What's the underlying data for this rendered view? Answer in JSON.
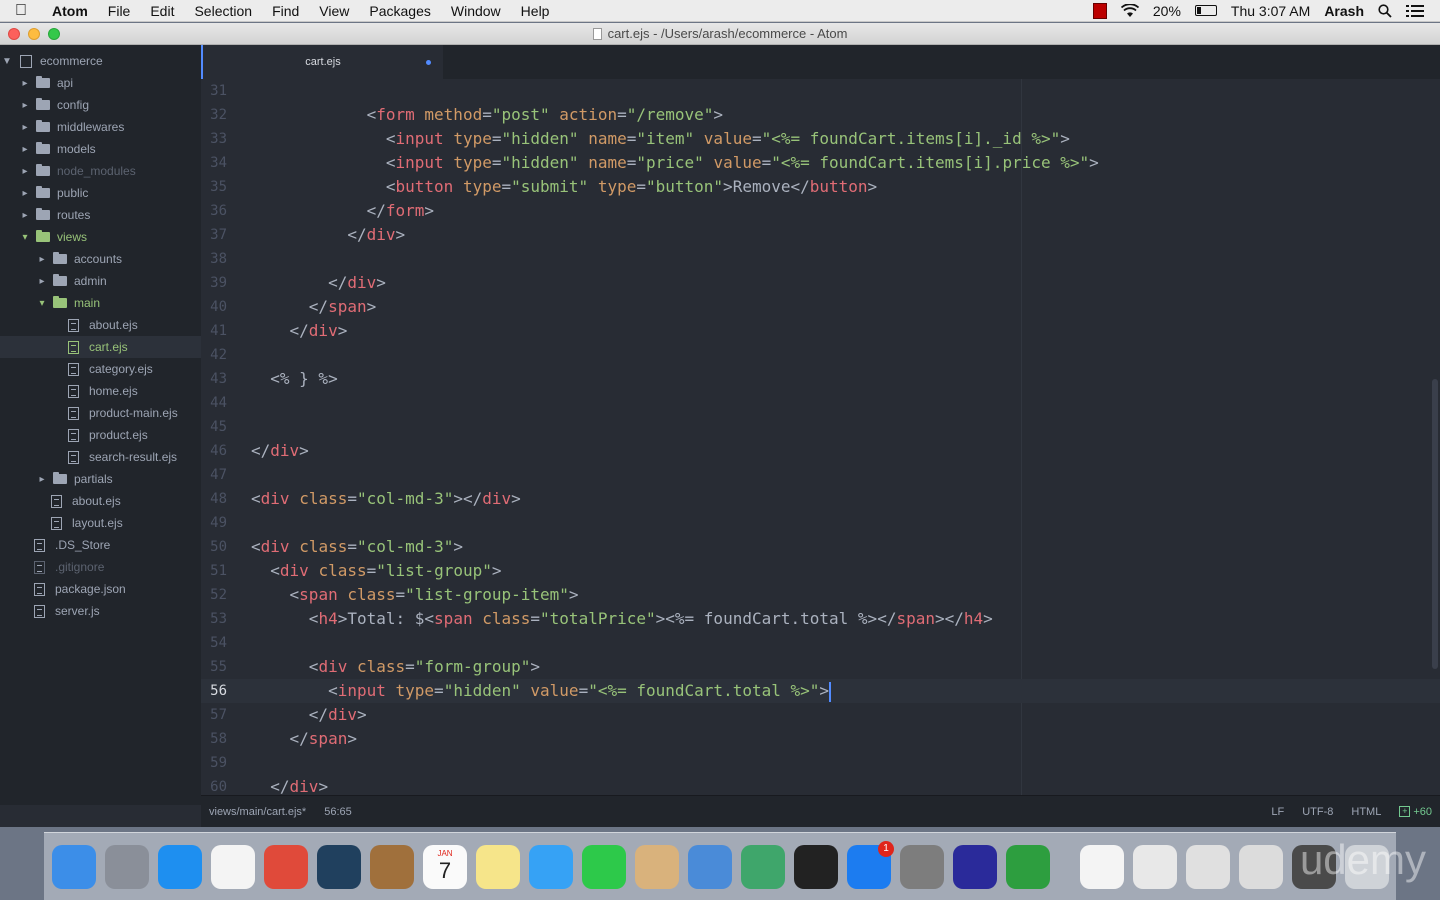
{
  "menubar": {
    "app": "Atom",
    "items": [
      "File",
      "Edit",
      "Selection",
      "Find",
      "View",
      "Packages",
      "Window",
      "Help"
    ],
    "battery": "20%",
    "clock": "Thu 3:07 AM",
    "user": "Arash"
  },
  "window": {
    "title": "cart.ejs - /Users/arash/ecommerce - Atom"
  },
  "tree": {
    "root": "ecommerce",
    "items": [
      {
        "label": "api",
        "kind": "folder",
        "depth": 1,
        "open": false
      },
      {
        "label": "config",
        "kind": "folder",
        "depth": 1,
        "open": false
      },
      {
        "label": "middlewares",
        "kind": "folder",
        "depth": 1,
        "open": false
      },
      {
        "label": "models",
        "kind": "folder",
        "depth": 1,
        "open": false
      },
      {
        "label": "node_modules",
        "kind": "folder",
        "depth": 1,
        "open": false,
        "dim": true
      },
      {
        "label": "public",
        "kind": "folder",
        "depth": 1,
        "open": false
      },
      {
        "label": "routes",
        "kind": "folder",
        "depth": 1,
        "open": false
      },
      {
        "label": "views",
        "kind": "folder",
        "depth": 1,
        "open": true,
        "green": true
      },
      {
        "label": "accounts",
        "kind": "folder",
        "depth": 2,
        "open": false
      },
      {
        "label": "admin",
        "kind": "folder",
        "depth": 2,
        "open": false
      },
      {
        "label": "main",
        "kind": "folder",
        "depth": 2,
        "open": true,
        "green": true
      },
      {
        "label": "about.ejs",
        "kind": "file",
        "depth": 3
      },
      {
        "label": "cart.ejs",
        "kind": "file",
        "depth": 3,
        "green": true,
        "selected": true
      },
      {
        "label": "category.ejs",
        "kind": "file",
        "depth": 3
      },
      {
        "label": "home.ejs",
        "kind": "file",
        "depth": 3
      },
      {
        "label": "product-main.ejs",
        "kind": "file",
        "depth": 3
      },
      {
        "label": "product.ejs",
        "kind": "file",
        "depth": 3
      },
      {
        "label": "search-result.ejs",
        "kind": "file",
        "depth": 3
      },
      {
        "label": "partials",
        "kind": "folder",
        "depth": 2,
        "open": false
      },
      {
        "label": "about.ejs",
        "kind": "file",
        "depth": 2
      },
      {
        "label": "layout.ejs",
        "kind": "file",
        "depth": 2
      },
      {
        "label": ".DS_Store",
        "kind": "file",
        "depth": 1
      },
      {
        "label": ".gitignore",
        "kind": "file",
        "depth": 1,
        "dim": true
      },
      {
        "label": "package.json",
        "kind": "file",
        "depth": 1
      },
      {
        "label": "server.js",
        "kind": "file",
        "depth": 1
      }
    ]
  },
  "tab": {
    "label": "cart.ejs",
    "modified": true
  },
  "editor": {
    "current_line": 56,
    "lines": [
      {
        "n": "31",
        "tokens": []
      },
      {
        "n": "32",
        "tokens": [
          [
            "ws",
            "            "
          ],
          [
            "pu",
            "<"
          ],
          [
            "tg",
            "form"
          ],
          [
            "ws",
            " "
          ],
          [
            "at",
            "method"
          ],
          [
            "pu",
            "="
          ],
          [
            "st",
            "\"post\""
          ],
          [
            "ws",
            " "
          ],
          [
            "at",
            "action"
          ],
          [
            "pu",
            "="
          ],
          [
            "st",
            "\"/remove\""
          ],
          [
            "pu",
            ">"
          ]
        ]
      },
      {
        "n": "33",
        "tokens": [
          [
            "ws",
            "              "
          ],
          [
            "pu",
            "<"
          ],
          [
            "tg",
            "input"
          ],
          [
            "ws",
            " "
          ],
          [
            "at",
            "type"
          ],
          [
            "pu",
            "="
          ],
          [
            "st",
            "\"hidden\""
          ],
          [
            "ws",
            " "
          ],
          [
            "at",
            "name"
          ],
          [
            "pu",
            "="
          ],
          [
            "st",
            "\"item\""
          ],
          [
            "ws",
            " "
          ],
          [
            "at",
            "value"
          ],
          [
            "pu",
            "="
          ],
          [
            "st",
            "\"<%= foundCart.items[i]._id %>\""
          ],
          [
            "pu",
            ">"
          ]
        ]
      },
      {
        "n": "34",
        "tokens": [
          [
            "ws",
            "              "
          ],
          [
            "pu",
            "<"
          ],
          [
            "tg",
            "input"
          ],
          [
            "ws",
            " "
          ],
          [
            "at",
            "type"
          ],
          [
            "pu",
            "="
          ],
          [
            "st",
            "\"hidden\""
          ],
          [
            "ws",
            " "
          ],
          [
            "at",
            "name"
          ],
          [
            "pu",
            "="
          ],
          [
            "st",
            "\"price\""
          ],
          [
            "ws",
            " "
          ],
          [
            "at",
            "value"
          ],
          [
            "pu",
            "="
          ],
          [
            "st",
            "\"<%= foundCart.items[i].price %>\""
          ],
          [
            "pu",
            ">"
          ]
        ]
      },
      {
        "n": "35",
        "tokens": [
          [
            "ws",
            "              "
          ],
          [
            "pu",
            "<"
          ],
          [
            "tg",
            "button"
          ],
          [
            "ws",
            " "
          ],
          [
            "at",
            "type"
          ],
          [
            "pu",
            "="
          ],
          [
            "st",
            "\"submit\""
          ],
          [
            "ws",
            " "
          ],
          [
            "at",
            "type"
          ],
          [
            "pu",
            "="
          ],
          [
            "st",
            "\"button\""
          ],
          [
            "pu",
            ">"
          ],
          [
            "tx",
            "Remove"
          ],
          [
            "pu",
            "</"
          ],
          [
            "tg",
            "button"
          ],
          [
            "pu",
            ">"
          ]
        ]
      },
      {
        "n": "36",
        "tokens": [
          [
            "ws",
            "            "
          ],
          [
            "pu",
            "</"
          ],
          [
            "tg",
            "form"
          ],
          [
            "pu",
            ">"
          ]
        ]
      },
      {
        "n": "37",
        "tokens": [
          [
            "ws",
            "          "
          ],
          [
            "pu",
            "</"
          ],
          [
            "tg",
            "div"
          ],
          [
            "pu",
            ">"
          ]
        ]
      },
      {
        "n": "38",
        "tokens": []
      },
      {
        "n": "39",
        "tokens": [
          [
            "ws",
            "        "
          ],
          [
            "pu",
            "</"
          ],
          [
            "tg",
            "div"
          ],
          [
            "pu",
            ">"
          ]
        ]
      },
      {
        "n": "40",
        "tokens": [
          [
            "ws",
            "      "
          ],
          [
            "pu",
            "</"
          ],
          [
            "tg",
            "span"
          ],
          [
            "pu",
            ">"
          ]
        ]
      },
      {
        "n": "41",
        "tokens": [
          [
            "ws",
            "    "
          ],
          [
            "pu",
            "</"
          ],
          [
            "tg",
            "div"
          ],
          [
            "pu",
            ">"
          ]
        ]
      },
      {
        "n": "42",
        "tokens": []
      },
      {
        "n": "43",
        "tokens": [
          [
            "ws",
            "  "
          ],
          [
            "tx",
            "<% } %>"
          ]
        ]
      },
      {
        "n": "44",
        "tokens": []
      },
      {
        "n": "45",
        "tokens": []
      },
      {
        "n": "46",
        "tokens": [
          [
            "pu",
            "</"
          ],
          [
            "tg",
            "div"
          ],
          [
            "pu",
            ">"
          ]
        ]
      },
      {
        "n": "47",
        "tokens": []
      },
      {
        "n": "48",
        "tokens": [
          [
            "pu",
            "<"
          ],
          [
            "tg",
            "div"
          ],
          [
            "ws",
            " "
          ],
          [
            "at",
            "class"
          ],
          [
            "pu",
            "="
          ],
          [
            "st",
            "\"col-md-3\""
          ],
          [
            "pu",
            "></"
          ],
          [
            "tg",
            "div"
          ],
          [
            "pu",
            ">"
          ]
        ]
      },
      {
        "n": "49",
        "tokens": []
      },
      {
        "n": "50",
        "tokens": [
          [
            "pu",
            "<"
          ],
          [
            "tg",
            "div"
          ],
          [
            "ws",
            " "
          ],
          [
            "at",
            "class"
          ],
          [
            "pu",
            "="
          ],
          [
            "st",
            "\"col-md-3\""
          ],
          [
            "pu",
            ">"
          ]
        ]
      },
      {
        "n": "51",
        "tokens": [
          [
            "ws",
            "  "
          ],
          [
            "pu",
            "<"
          ],
          [
            "tg",
            "div"
          ],
          [
            "ws",
            " "
          ],
          [
            "at",
            "class"
          ],
          [
            "pu",
            "="
          ],
          [
            "st",
            "\"list-group\""
          ],
          [
            "pu",
            ">"
          ]
        ]
      },
      {
        "n": "52",
        "tokens": [
          [
            "ws",
            "    "
          ],
          [
            "pu",
            "<"
          ],
          [
            "tg",
            "span"
          ],
          [
            "ws",
            " "
          ],
          [
            "at",
            "class"
          ],
          [
            "pu",
            "="
          ],
          [
            "st",
            "\"list-group-item\""
          ],
          [
            "pu",
            ">"
          ]
        ]
      },
      {
        "n": "53",
        "tokens": [
          [
            "ws",
            "      "
          ],
          [
            "pu",
            "<"
          ],
          [
            "tg",
            "h4"
          ],
          [
            "pu",
            ">"
          ],
          [
            "tx",
            "Total: $"
          ],
          [
            "pu",
            "<"
          ],
          [
            "tg",
            "span"
          ],
          [
            "ws",
            " "
          ],
          [
            "at",
            "class"
          ],
          [
            "pu",
            "="
          ],
          [
            "st",
            "\"totalPrice\""
          ],
          [
            "pu",
            ">"
          ],
          [
            "tx",
            "<%= foundCart.total %>"
          ],
          [
            "pu",
            "</"
          ],
          [
            "tg",
            "span"
          ],
          [
            "pu",
            "></"
          ],
          [
            "tg",
            "h4"
          ],
          [
            "pu",
            ">"
          ]
        ]
      },
      {
        "n": "54",
        "tokens": []
      },
      {
        "n": "55",
        "tokens": [
          [
            "ws",
            "      "
          ],
          [
            "pu",
            "<"
          ],
          [
            "tg",
            "div"
          ],
          [
            "ws",
            " "
          ],
          [
            "at",
            "class"
          ],
          [
            "pu",
            "="
          ],
          [
            "st",
            "\"form-group\""
          ],
          [
            "pu",
            ">"
          ]
        ]
      },
      {
        "n": "56",
        "tokens": [
          [
            "ws",
            "        "
          ],
          [
            "pu",
            "<"
          ],
          [
            "tg",
            "input"
          ],
          [
            "ws",
            " "
          ],
          [
            "at",
            "type"
          ],
          [
            "pu",
            "="
          ],
          [
            "st",
            "\"hidden\""
          ],
          [
            "ws",
            " "
          ],
          [
            "at",
            "value"
          ],
          [
            "pu",
            "="
          ],
          [
            "st",
            "\"<%= foundCart.total %>\""
          ],
          [
            "pu",
            ">"
          ]
        ],
        "cursor": true
      },
      {
        "n": "57",
        "tokens": [
          [
            "ws",
            "      "
          ],
          [
            "pu",
            "</"
          ],
          [
            "tg",
            "div"
          ],
          [
            "pu",
            ">"
          ]
        ]
      },
      {
        "n": "58",
        "tokens": [
          [
            "ws",
            "    "
          ],
          [
            "pu",
            "</"
          ],
          [
            "tg",
            "span"
          ],
          [
            "pu",
            ">"
          ]
        ]
      },
      {
        "n": "59",
        "tokens": []
      },
      {
        "n": "60",
        "tokens": [
          [
            "ws",
            "  "
          ],
          [
            "pu",
            "</"
          ],
          [
            "tg",
            "div"
          ],
          [
            "pu",
            ">"
          ]
        ]
      }
    ]
  },
  "status": {
    "path": "views/main/cart.ejs*",
    "cursor": "56:65",
    "line_ending": "LF",
    "encoding": "UTF-8",
    "grammar": "HTML",
    "git": "+60"
  },
  "dock": {
    "icons": [
      {
        "name": "finder-icon",
        "color": "#3c8ee8"
      },
      {
        "name": "launchpad-icon",
        "color": "#8a8f99"
      },
      {
        "name": "safari-icon",
        "color": "#1e8ff0"
      },
      {
        "name": "app-grid-icon",
        "color": "#f4f4f4"
      },
      {
        "name": "chrome-icon",
        "color": "#e04a3a"
      },
      {
        "name": "quicktime-icon",
        "color": "#20405e"
      },
      {
        "name": "contacts-icon",
        "color": "#a0703c"
      },
      {
        "name": "calendar-icon",
        "color": "#fafafa"
      },
      {
        "name": "notes-icon",
        "color": "#f6e58a"
      },
      {
        "name": "messages-icon",
        "color": "#36a2f5"
      },
      {
        "name": "facetime-icon",
        "color": "#2dc94a"
      },
      {
        "name": "preview-icon",
        "color": "#d9b27c"
      },
      {
        "name": "keynote-icon",
        "color": "#4a8bd8"
      },
      {
        "name": "atom-icon",
        "color": "#3fa66b"
      },
      {
        "name": "terminal-icon",
        "color": "#222222"
      },
      {
        "name": "app-store-icon",
        "color": "#1c7cf0",
        "badge": "1"
      },
      {
        "name": "system-preferences-icon",
        "color": "#7d7d7d"
      },
      {
        "name": "audacity-icon",
        "color": "#2a2a9a"
      },
      {
        "name": "camtasia-icon",
        "color": "#2d9e3f"
      }
    ],
    "docs": [
      {
        "name": "document-icon",
        "color": "#f4f4f4"
      },
      {
        "name": "screenshot-icon",
        "color": "#e8e8e8"
      },
      {
        "name": "chrome-download-icon",
        "color": "#e0e0e0"
      },
      {
        "name": "keyboard-icon",
        "color": "#dcdcdc"
      },
      {
        "name": "camtasia-file-icon",
        "color": "#4a4a4a"
      },
      {
        "name": "trash-icon",
        "color": "#cfd3d8"
      }
    ],
    "calendar_month": "JAN",
    "calendar_day": "7",
    "watermark": "udemy"
  }
}
